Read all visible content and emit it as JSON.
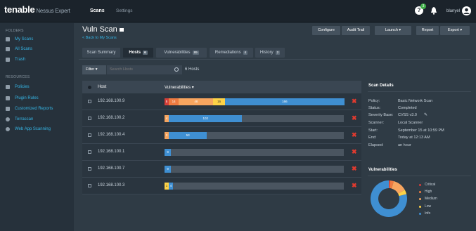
{
  "header": {
    "brand": "tenable",
    "brand_sub": "Nessus Expert",
    "nav_scans": "Scans",
    "nav_settings": "Settings",
    "notification_count": "3",
    "user_name": "blanyel"
  },
  "sidebar": {
    "folders_heading": "FOLDERS",
    "folders": [
      {
        "label": "My Scans",
        "icon": "folder-icon"
      },
      {
        "label": "All Scans",
        "icon": "folder-icon"
      },
      {
        "label": "Trash",
        "icon": "trash-icon"
      }
    ],
    "resources_heading": "RESOURCES",
    "resources": [
      {
        "label": "Policies",
        "icon": "shield-icon"
      },
      {
        "label": "Plugin Rules",
        "icon": "plugin-icon"
      },
      {
        "label": "Customized Reports",
        "icon": "report-icon"
      },
      {
        "label": "Terrascan",
        "icon": "terrascan-icon"
      },
      {
        "label": "Web App Scanning",
        "icon": "globe-icon"
      }
    ]
  },
  "scan": {
    "title": "Vuln Scan",
    "back_link": "< Back to My Scans"
  },
  "toolbar": {
    "configure": "Configure",
    "audit_trail": "Audit Trail",
    "launch": "Launch ▾",
    "report": "Report",
    "export": "Export ▾"
  },
  "tabs": [
    {
      "label": "Scan Summary",
      "count": ""
    },
    {
      "label": "Hosts",
      "count": "6"
    },
    {
      "label": "Vulnerabilities",
      "count": "89"
    },
    {
      "label": "Remediations",
      "count": "4"
    },
    {
      "label": "History",
      "count": "2"
    }
  ],
  "filter": {
    "label": "Filter ▾",
    "search_placeholder": "Search Hosts",
    "hosts_count": "6 Hosts"
  },
  "table": {
    "col_host": "Host",
    "col_vulns": "Vulnerabilities ▾",
    "rows": [
      {
        "host": "192.168.100.9",
        "critical": 5,
        "high": 14,
        "medium": 48,
        "low": 16,
        "info": 166
      },
      {
        "host": "192.168.100.2",
        "critical": 0,
        "high": 0,
        "medium": 4,
        "low": 0,
        "info": 102
      },
      {
        "host": "192.168.100.4",
        "critical": 0,
        "high": 0,
        "medium": 3,
        "low": 0,
        "info": 53
      },
      {
        "host": "192.168.100.1",
        "critical": 0,
        "high": 0,
        "medium": 0,
        "low": 0,
        "info": 9
      },
      {
        "host": "192.168.100.7",
        "critical": 0,
        "high": 0,
        "medium": 0,
        "low": 0,
        "info": 9
      },
      {
        "host": "192.168.100.3",
        "critical": 0,
        "high": 0,
        "medium": 0,
        "low": 1,
        "info": 4
      }
    ]
  },
  "scan_details": {
    "heading": "Scan Details",
    "items": [
      {
        "label": "Policy:",
        "value": "Basic Network Scan"
      },
      {
        "label": "Status:",
        "value": "Completed"
      },
      {
        "label": "Severity Base:",
        "value": "CVSS v3.0"
      },
      {
        "label": "Scanner:",
        "value": "Local Scanner"
      },
      {
        "label": "Start:",
        "value": "September 15 at 10:59 PM"
      },
      {
        "label": "End:",
        "value": "Today at 12:13 AM"
      },
      {
        "label": "Elapsed:",
        "value": "an hour"
      }
    ]
  },
  "vulnerabilities_panel": {
    "heading": "Vulnerabilities",
    "legend": [
      {
        "label": "Critical",
        "color": "#d43f3a"
      },
      {
        "label": "High",
        "color": "#ee7b41"
      },
      {
        "label": "Medium",
        "color": "#f7a55f"
      },
      {
        "label": "Low",
        "color": "#fdd247"
      },
      {
        "label": "Info",
        "color": "#3f8fd2"
      }
    ]
  },
  "colors": {
    "critical": "#d43f3a",
    "high": "#ee7b41",
    "medium": "#f7a55f",
    "low": "#fdd247",
    "info": "#3f8fd2",
    "accent_link": "#35b6e6",
    "delete": "#e03a2f"
  }
}
